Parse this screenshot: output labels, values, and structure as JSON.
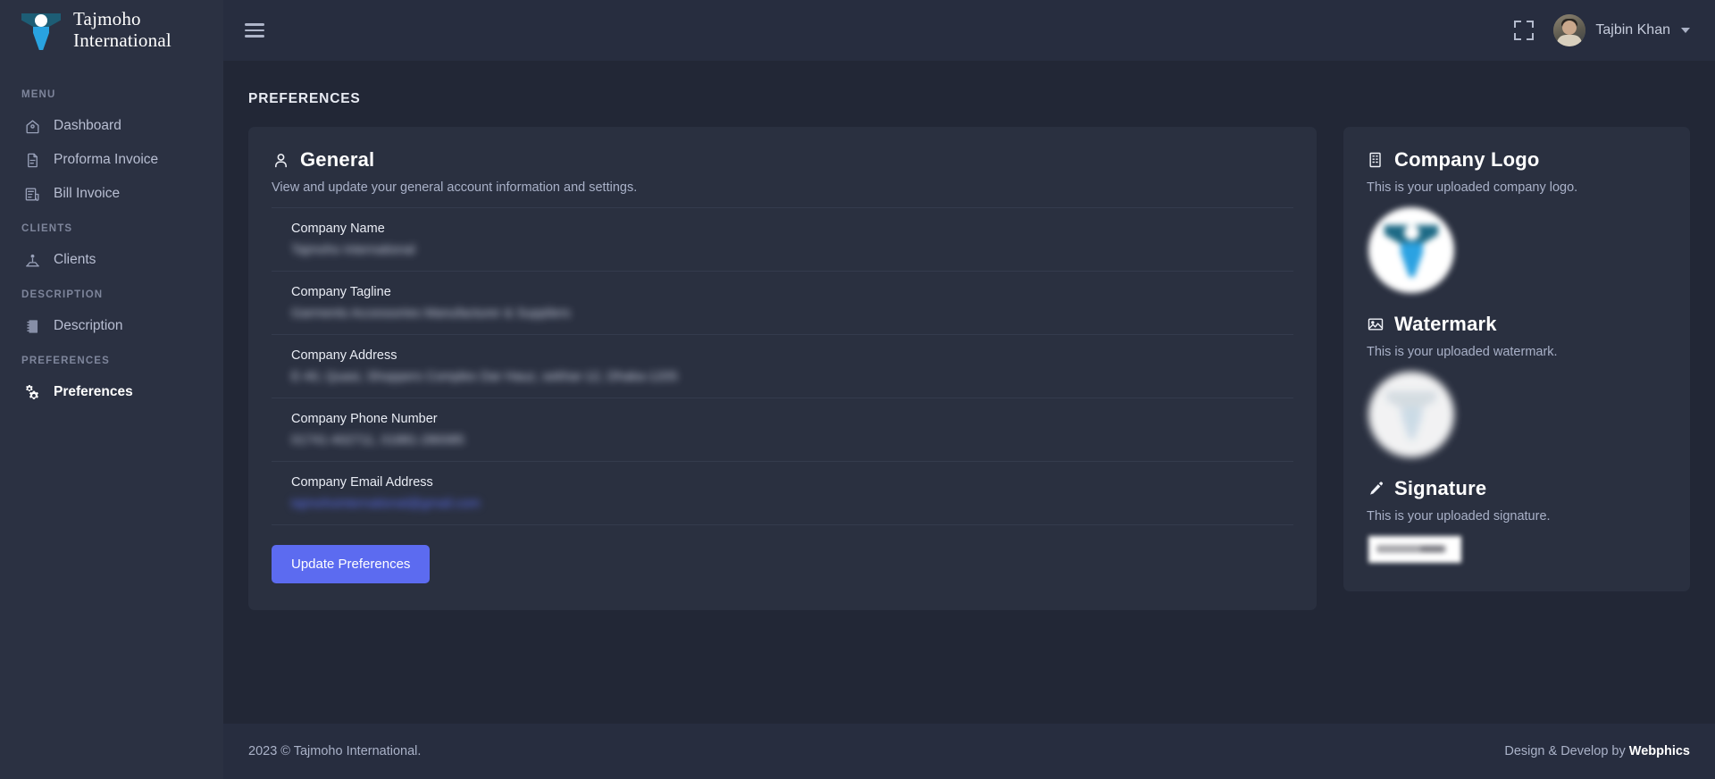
{
  "brand": {
    "line1": "Tajmoho",
    "line2": "International",
    "logo_icon": "tajmoho-figure-logo"
  },
  "sidebar": {
    "sections": [
      {
        "label": "MENU",
        "items": [
          {
            "label": "Dashboard",
            "icon": "home-icon",
            "active": false
          },
          {
            "label": "Proforma Invoice",
            "icon": "document-icon",
            "active": false
          },
          {
            "label": "Bill Invoice",
            "icon": "invoice-list-icon",
            "active": false
          }
        ]
      },
      {
        "label": "CLIENTS",
        "items": [
          {
            "label": "Clients",
            "icon": "users-icon",
            "active": false
          }
        ]
      },
      {
        "label": "DESCRIPTION",
        "items": [
          {
            "label": "Description",
            "icon": "notebook-icon",
            "active": false
          }
        ]
      },
      {
        "label": "PREFERENCES",
        "items": [
          {
            "label": "Preferences",
            "icon": "gears-icon",
            "active": true
          }
        ]
      }
    ]
  },
  "topbar": {
    "menu_toggle_icon": "hamburger-icon",
    "fullscreen_icon": "fullscreen-icon",
    "user_name": "Tajbin Khan",
    "chevron_icon": "chevron-down-icon",
    "avatar_icon": "user-avatar"
  },
  "page": {
    "title": "PREFERENCES"
  },
  "general": {
    "icon": "person-icon",
    "title": "General",
    "subtitle": "View and update your general account information and settings.",
    "rows": [
      {
        "label": "Company Name",
        "value": "Tajmoho International",
        "redacted": true,
        "link": false
      },
      {
        "label": "Company Tagline",
        "value": "Garments Accessories Manufacturer & Suppliers",
        "redacted": true,
        "link": false
      },
      {
        "label": "Company Address",
        "value": "E-40, Quasi, Shoppers Complex Dar Hauz, sekhar-12, Dhaka-1205",
        "redacted": true,
        "link": false
      },
      {
        "label": "Company Phone Number",
        "value": "01741-402711, 01881-280085",
        "redacted": true,
        "link": false
      },
      {
        "label": "Company Email Address",
        "value": "tajmohointernational@gmail.com",
        "redacted": true,
        "link": true
      }
    ],
    "update_button": "Update Preferences"
  },
  "assets": {
    "logo": {
      "icon": "building-icon",
      "title": "Company Logo",
      "subtitle": "This is your uploaded company logo.",
      "image_name": "company-logo-image"
    },
    "watermark": {
      "icon": "image-icon",
      "title": "Watermark",
      "subtitle": "This is your uploaded watermark.",
      "image_name": "watermark-image"
    },
    "signature": {
      "icon": "pencil-icon",
      "title": "Signature",
      "subtitle": "This is your uploaded signature.",
      "image_name": "signature-image"
    }
  },
  "footer": {
    "copyright": "2023 © Tajmoho International.",
    "credit_prefix": "Design & Develop by ",
    "credit_brand": "Webphics"
  },
  "colors": {
    "sidebar_bg": "#2b3142",
    "topbar_bg": "#272d3f",
    "page_bg": "#222736",
    "card_bg": "#2a3040",
    "accent": "#5c6bf0",
    "link": "#5b6ef0",
    "logo_teal": "#1d5d75",
    "logo_blue": "#29a3e0"
  }
}
